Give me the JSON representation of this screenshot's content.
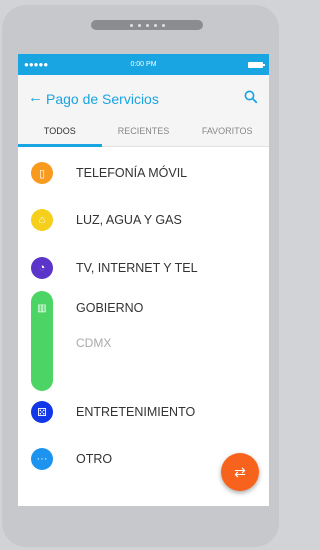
{
  "status_bar": {
    "signal": "●●●●●",
    "time": "0:00 PM"
  },
  "header": {
    "title": "Pago de Servicios",
    "back_icon": "arrow-left-icon",
    "search_icon": "search-icon"
  },
  "tabs": [
    {
      "label": "TODOS",
      "active": true
    },
    {
      "label": "RECIENTES",
      "active": false
    },
    {
      "label": "FAVORITOS",
      "active": false
    }
  ],
  "services": [
    {
      "label": "TELEFONÍA MÓVIL",
      "icon": "mobile-phone-icon",
      "color": "#f79a1e"
    },
    {
      "label": "LUZ, AGUA Y GAS",
      "icon": "house-icon",
      "color": "#f5cf1b"
    },
    {
      "label": "TV, INTERNET Y TEL",
      "icon": "satellite-icon",
      "color": "#5b35c9"
    },
    {
      "label": "GOBIERNO",
      "icon": "building-icon",
      "color": "#4cd464",
      "sub": "CDMX"
    },
    {
      "label": "ENTRETENIMIENTO",
      "icon": "dice-icon",
      "color": "#1237e6"
    },
    {
      "label": "OTRO",
      "icon": "more-icon",
      "color": "#1c94ef"
    }
  ],
  "fab": {
    "icon": "transfer-arrows-icon",
    "color": "#f7631c"
  }
}
